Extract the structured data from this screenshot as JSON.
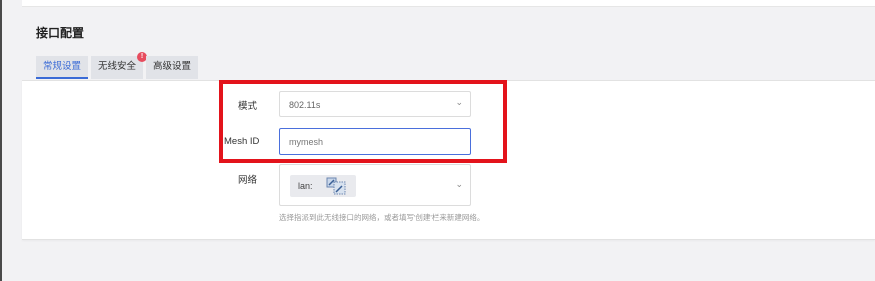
{
  "section": {
    "title": "接口配置"
  },
  "tabs": [
    {
      "label": "常规设置",
      "active": true
    },
    {
      "label": "无线安全",
      "badge": "!"
    },
    {
      "label": "高级设置"
    }
  ],
  "form": {
    "mode_label": "模式",
    "mode_value": "802.11s",
    "mesh_label": "Mesh ID",
    "mesh_value": "mymesh",
    "network_label": "网络",
    "network_chip": "lan:",
    "network_hint": "选择指派到此无线接口的网络，或者填写'创建'栏来新建网络。"
  },
  "icons": {
    "dropdown": "chevron-down-icon",
    "badge": "alert-badge-icon",
    "network": "network-ports-icon"
  },
  "colors": {
    "accent": "#3a6bd6",
    "badge": "#e74c5e",
    "highlight": "#e3131b"
  }
}
